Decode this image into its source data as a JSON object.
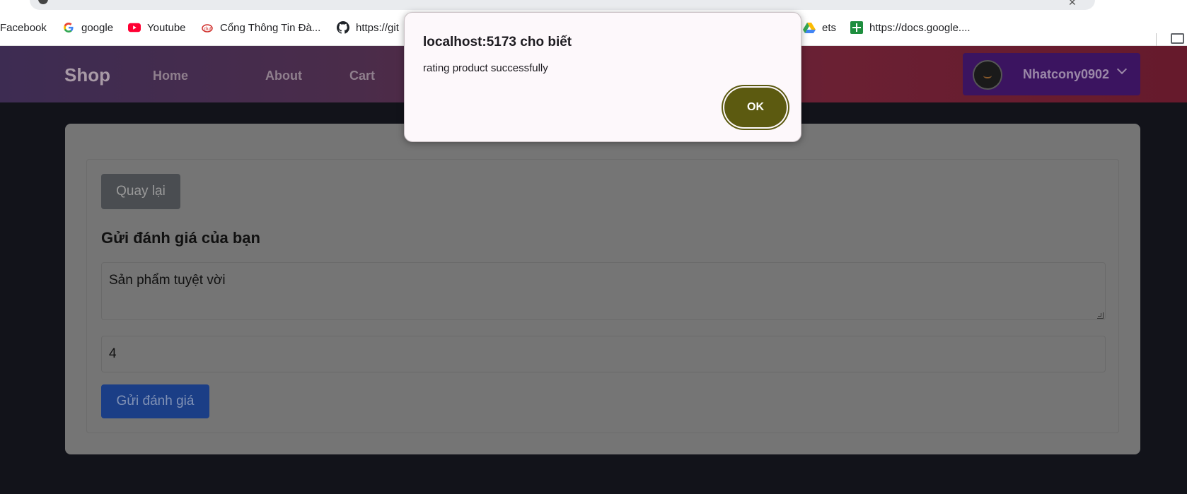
{
  "bookmarks": [
    {
      "label": "Facebook",
      "icon": "facebook-icon"
    },
    {
      "label": "google",
      "icon": "google-icon"
    },
    {
      "label": "Youtube",
      "icon": "youtube-icon"
    },
    {
      "label": "Cổng Thông Tin Đà...",
      "icon": "portal-icon"
    },
    {
      "label": "https://git",
      "icon": "github-icon"
    },
    {
      "label": "ets",
      "icon": "drive-icon"
    },
    {
      "label": "https://docs.google....",
      "icon": "sheets-icon"
    }
  ],
  "nav": {
    "brand": "Shop",
    "links": [
      "Home",
      "About",
      "Cart"
    ],
    "username": "Nhatcony0902"
  },
  "form": {
    "back_label": "Quay lại",
    "heading": "Gửi đánh giá của bạn",
    "comment": "Sản phẩm tuyệt vời",
    "rating": "4",
    "submit_label": "Gửi đánh giá"
  },
  "dialog": {
    "title": "localhost:5173 cho biết",
    "message": "rating product successfully",
    "ok_label": "OK"
  },
  "colors": {
    "dialog_button": "#5c5a10",
    "submit_button": "#1b3e86",
    "user_box": "#3b1460"
  }
}
